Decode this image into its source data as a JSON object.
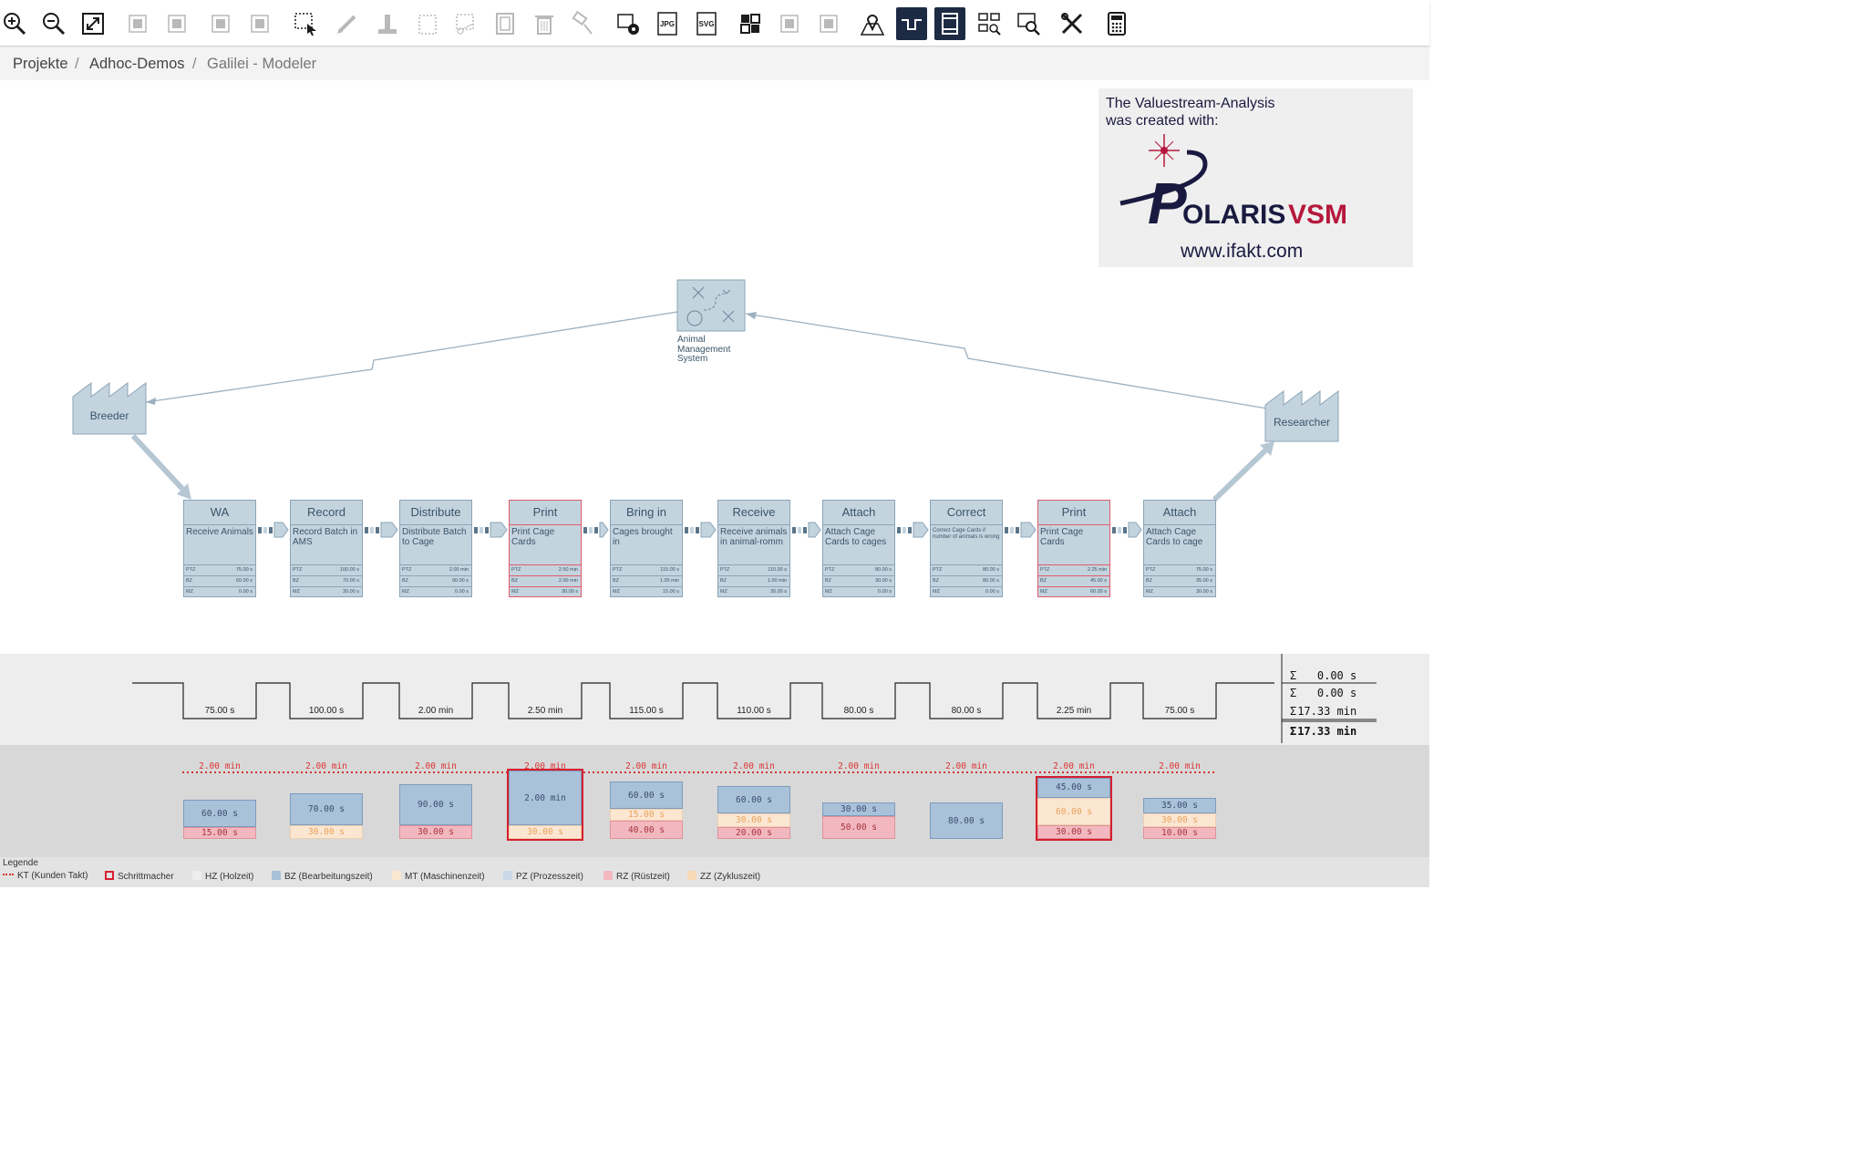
{
  "toolbar": {
    "items": [
      {
        "icon": "zoom-in-icon",
        "enabled": true
      },
      {
        "icon": "zoom-out-icon",
        "enabled": true
      },
      {
        "icon": "fit-screen-icon",
        "enabled": true
      },
      {
        "icon": "align-left-icon",
        "enabled": false
      },
      {
        "icon": "align-center-icon",
        "enabled": false
      },
      {
        "icon": "align-vertical-icon",
        "enabled": false
      },
      {
        "icon": "align-horizontal-icon",
        "enabled": false
      },
      {
        "icon": "select-area-icon",
        "enabled": true
      },
      {
        "icon": "pencil-icon",
        "enabled": false
      },
      {
        "icon": "stamp-icon",
        "enabled": false
      },
      {
        "icon": "copy-icon",
        "enabled": false
      },
      {
        "icon": "cut-icon",
        "enabled": false
      },
      {
        "icon": "paste-icon",
        "enabled": false
      },
      {
        "icon": "delete-icon",
        "enabled": false
      },
      {
        "icon": "paint-icon",
        "enabled": false
      },
      {
        "icon": "export-settings-icon",
        "enabled": true
      },
      {
        "icon": "export-jpg-icon",
        "label": "JPG",
        "enabled": true
      },
      {
        "icon": "export-svg-icon",
        "label": "SVG",
        "enabled": true
      },
      {
        "icon": "arrange-icon",
        "enabled": true
      },
      {
        "icon": "move-up-icon",
        "enabled": false
      },
      {
        "icon": "move-down-icon",
        "enabled": false
      },
      {
        "icon": "map-pin-icon",
        "enabled": true
      },
      {
        "icon": "timeline-icon",
        "enabled": true,
        "active": true
      },
      {
        "icon": "panel-icon",
        "enabled": true,
        "active": true
      },
      {
        "icon": "inspect-icon",
        "enabled": true
      },
      {
        "icon": "analysis-icon",
        "enabled": true
      },
      {
        "icon": "tools-icon",
        "enabled": true
      },
      {
        "icon": "calculator-icon",
        "enabled": true
      }
    ]
  },
  "breadcrumb": {
    "items": [
      "Projekte",
      "Adhoc-Demos",
      "Galilei - Modeler"
    ]
  },
  "watermark": {
    "caption_line1": "The Valuestream-Analysis",
    "caption_line2": "was created with:",
    "logo_text": "OLARIS",
    "logo_initial": "P",
    "logo_vsm": "VSM",
    "url": "www.ifakt.com"
  },
  "entities": {
    "breeder": "Breeder",
    "researcher": "Researcher",
    "system_line1": "Animal",
    "system_line2": "Management",
    "system_line3": "System"
  },
  "process_labels": {
    "ptz": "PTZ",
    "bz": "BZ",
    "mz": "MZ"
  },
  "processes": [
    {
      "title": "WA",
      "desc": "Receive Animals",
      "ptz": "75.00 s",
      "bz": "60.00 s",
      "mz": "0.00 s",
      "pacemaker": false,
      "timeline": "75.00 s",
      "kt": "2.00 min",
      "bz_bar": "60.00 s",
      "mt_bar": "",
      "rz_bar": "15.00 s"
    },
    {
      "title": "Record",
      "desc": "Record Batch in AMS",
      "ptz": "100.00 s",
      "bz": "70.00 s",
      "mz": "30.00 s",
      "pacemaker": false,
      "timeline": "100.00 s",
      "kt": "2.00 min",
      "bz_bar": "70.00 s",
      "mt_bar": "30.00 s",
      "rz_bar": ""
    },
    {
      "title": "Distribute",
      "desc": "Distribute Batch to Cage",
      "ptz": "2.00 min",
      "bz": "90.00 s",
      "mz": "0.00 s",
      "pacemaker": false,
      "timeline": "2.00 min",
      "kt": "2.00 min",
      "bz_bar": "90.00 s",
      "mt_bar": "",
      "rz_bar": "30.00 s"
    },
    {
      "title": "Print",
      "desc": "Print Cage Cards",
      "ptz": "2.50 min",
      "bz": "2.00 min",
      "mz": "30.00 s",
      "pacemaker": true,
      "timeline": "2.50 min",
      "kt": "2.00 min",
      "bz_bar": "2.00 min",
      "mt_bar": "30.00 s",
      "rz_bar": ""
    },
    {
      "title": "Bring in",
      "desc": "Cages brought in",
      "ptz": "115.00 s",
      "bz": "1.00 min",
      "mz": "15.00 s",
      "pacemaker": false,
      "timeline": "115.00 s",
      "kt": "2.00 min",
      "bz_bar": "60.00 s",
      "mt_bar": "15.00 s",
      "rz_bar": "40.00 s"
    },
    {
      "title": "Receive",
      "desc": "Receive animals in animal-romm",
      "ptz": "110.00 s",
      "bz": "1.00 min",
      "mz": "30.00 s",
      "pacemaker": false,
      "timeline": "110.00 s",
      "kt": "2.00 min",
      "bz_bar": "60.00 s",
      "mt_bar": "30.00 s",
      "rz_bar": "20.00 s"
    },
    {
      "title": "Attach",
      "desc": "Attach Cage Cards to cages",
      "ptz": "80.00 s",
      "bz": "30.00 s",
      "mz": "0.00 s",
      "pacemaker": false,
      "timeline": "80.00 s",
      "kt": "2.00 min",
      "bz_bar": "30.00 s",
      "mt_bar": "",
      "rz_bar": "50.00 s"
    },
    {
      "title": "Correct",
      "desc": "Correct Cage Cards if number of animals is wrong",
      "ptz": "80.00 s",
      "bz": "80.00 s",
      "mz": "0.00 s",
      "pacemaker": false,
      "timeline": "80.00 s",
      "kt": "2.00 min",
      "bz_bar": "80.00 s",
      "mt_bar": "",
      "rz_bar": ""
    },
    {
      "title": "Print",
      "desc": "Print Cage Cards",
      "ptz": "2.25 min",
      "bz": "45.00 s",
      "mz": "60.00 s",
      "pacemaker": true,
      "timeline": "2.25 min",
      "kt": "2.00 min",
      "bz_bar": "45.00 s",
      "mt_bar": "60.00 s",
      "rz_bar": "30.00 s"
    },
    {
      "title": "Attach",
      "desc": "Attach Cage Cards to cage",
      "ptz": "75.00 s",
      "bz": "35.00 s",
      "mz": "30.00 s",
      "pacemaker": false,
      "timeline": "75.00 s",
      "kt": "2.00 min",
      "bz_bar": "35.00 s",
      "mt_bar": "30.00 s",
      "rz_bar": "10.00 s"
    }
  ],
  "sums": [
    {
      "symbol": "Σ",
      "value": "0.00 s"
    },
    {
      "symbol": "Σ",
      "value": "0.00 s"
    },
    {
      "symbol": "Σ",
      "value": "17.33 min"
    },
    {
      "symbol": "Σ",
      "value": "17.33 min"
    }
  ],
  "legend": {
    "title": "Legende",
    "items": [
      {
        "label": "KT (Kunden Takt)",
        "color": "#d33333",
        "style": "dotted"
      },
      {
        "label": "Schrittmacher",
        "color": "#d61f2e",
        "style": "outline"
      },
      {
        "label": "HZ (Holzeit)",
        "color": "#eeeeee",
        "style": "fill"
      },
      {
        "label": "BZ (Bearbeitungszeit)",
        "color": "#a9c1d9",
        "style": "fill"
      },
      {
        "label": "MT (Maschinenzeit)",
        "color": "#fbe6d2",
        "style": "fill"
      },
      {
        "label": "PZ (Prozesszeit)",
        "color": "#c9d8e6",
        "style": "fill"
      },
      {
        "label": "RZ (Rüstzeit)",
        "color": "#f3b8bf",
        "style": "fill"
      },
      {
        "label": "ZZ (Zykluszeit)",
        "color": "#f7d9b8",
        "style": "fill"
      }
    ]
  },
  "colors": {
    "accent": "#1d2a44",
    "process_fill": "#c4d4df",
    "pacemaker": "#d61f2e",
    "takt_line": "#d33333"
  }
}
